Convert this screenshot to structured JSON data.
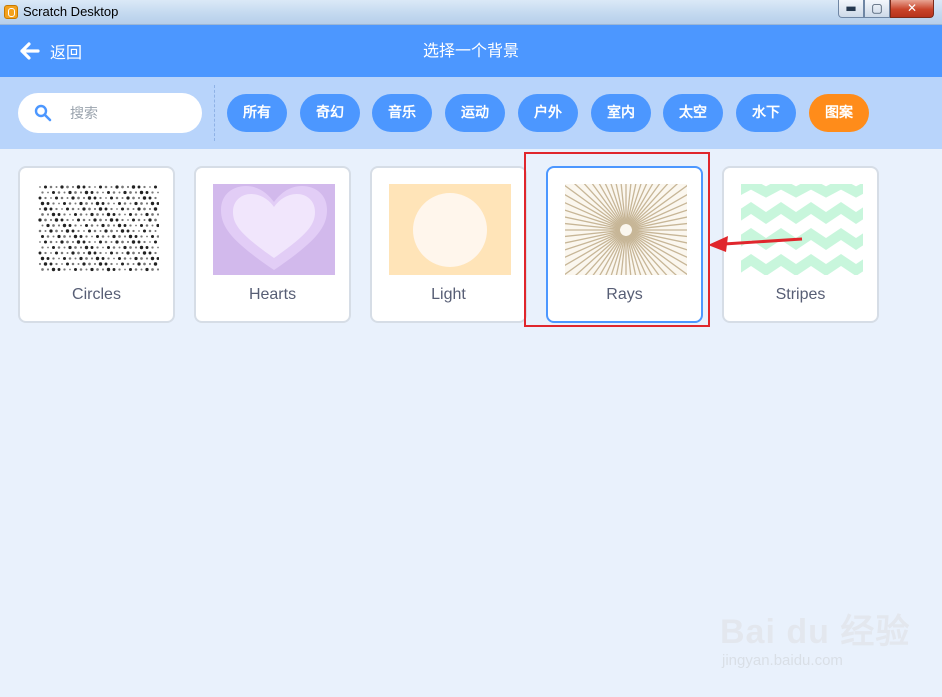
{
  "window": {
    "title": "Scratch Desktop",
    "min_glyph": "▬",
    "max_glyph": "▢",
    "close_glyph": "✕"
  },
  "header": {
    "back_label": "返回",
    "title": "选择一个背景"
  },
  "search": {
    "placeholder": "搜索",
    "value": ""
  },
  "tags": [
    {
      "label": "所有",
      "active": false
    },
    {
      "label": "奇幻",
      "active": false
    },
    {
      "label": "音乐",
      "active": false
    },
    {
      "label": "运动",
      "active": false
    },
    {
      "label": "户外",
      "active": false
    },
    {
      "label": "室内",
      "active": false
    },
    {
      "label": "太空",
      "active": false
    },
    {
      "label": "水下",
      "active": false
    },
    {
      "label": "图案",
      "active": true
    }
  ],
  "backdrops": [
    {
      "name": "Circles",
      "selected": false
    },
    {
      "name": "Hearts",
      "selected": false
    },
    {
      "name": "Light",
      "selected": false
    },
    {
      "name": "Rays",
      "selected": true
    },
    {
      "name": "Stripes",
      "selected": false
    }
  ],
  "watermark": {
    "logo": "Bai du 经验",
    "url": "jingyan.baidu.com"
  },
  "colors": {
    "header": "#4c97ff",
    "filterbar": "#b8d4fb",
    "active_tag": "#ff8c1a",
    "annotation": "#e0262c"
  }
}
